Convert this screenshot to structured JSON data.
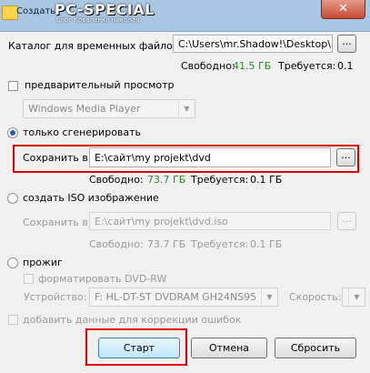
{
  "window": {
    "title": "Создать",
    "brand": "PC-SPECIAL",
    "brand_sub": "блог Коваленко николая",
    "close_symbol": "✕"
  },
  "temp_dir": {
    "label": "Каталог для временных файлов:",
    "value": "C:\\Users\\mr.Shadow!\\Desktop\\",
    "browse": "...",
    "free_label": "Свободно:",
    "free_value": "41.5 ГБ",
    "required_label": "Требуется:",
    "required_value": "0.1"
  },
  "preview": {
    "label": "предварительный просмотр",
    "player": "Windows Media Player"
  },
  "generate_only": {
    "label": "только сгенерировать",
    "save_label": "Сохранить в:",
    "save_value": "E:\\сайт\\my projekt\\dvd",
    "browse": "...",
    "free_label": "Свободно:",
    "free_value": "73.7 ГБ",
    "required_label": "Требуется:",
    "required_value": "0.1 ГБ"
  },
  "iso": {
    "label": "создать ISO изображение",
    "save_label": "Сохранить в:",
    "save_value": "E:\\сайт\\my projekt\\dvd.iso",
    "browse": "...",
    "free_label": "Свободно:",
    "free_value": "73.7 ГБ",
    "required_label": "Требуется:",
    "required_value": "0.1 ГБ"
  },
  "burn": {
    "label": "прожиг",
    "format_label": "форматировать DVD-RW",
    "device_label": "Устройство:",
    "device_value": "F: HL-DT-ST DVDRAM GH24NS95",
    "speed_label": "Скорость:",
    "speed_value": ""
  },
  "ecc": {
    "label": "добавить данные для коррекции ошибок"
  },
  "buttons": {
    "start": "Старт",
    "cancel": "Отмена",
    "reset": "Сбросить"
  },
  "colors": {
    "free_space": "#2a8a2a",
    "highlight": "#e00000"
  }
}
